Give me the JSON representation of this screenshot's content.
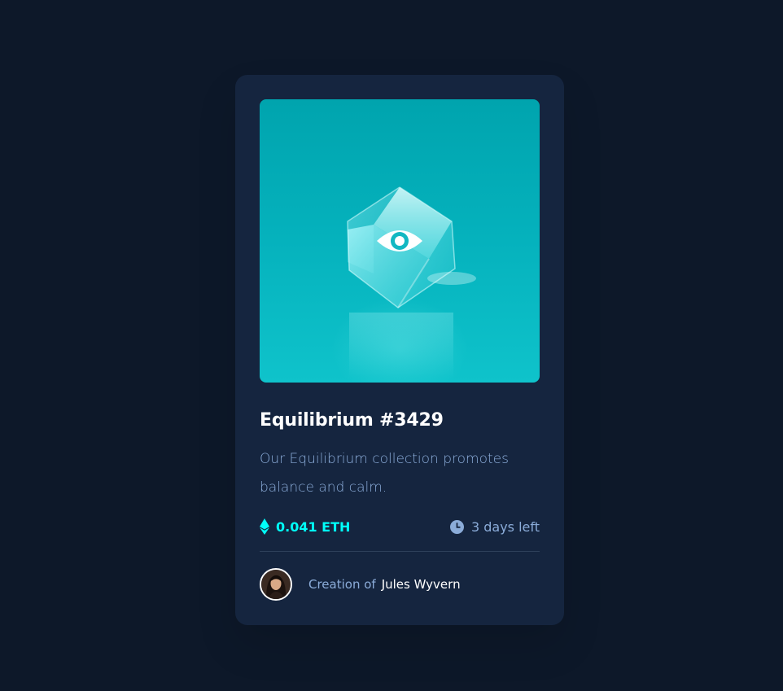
{
  "card": {
    "title": "Equilibrium #3429",
    "description": "Our Equilibrium collection promotes balance and calm.",
    "price": "0.041 ETH",
    "time_left": "3 days left",
    "creator_prefix": "Creation of",
    "creator_name": "Jules Wyvern"
  },
  "icons": {
    "image_overlay": "eye-icon",
    "price": "ethereum-icon",
    "time": "clock-icon"
  },
  "colors": {
    "page_background": "#0d1829",
    "card_background": "#15253f",
    "accent_cyan": "#00fff8",
    "soft_blue": "#8bacd9",
    "white": "#ffffff",
    "divider": "#2e405a"
  }
}
